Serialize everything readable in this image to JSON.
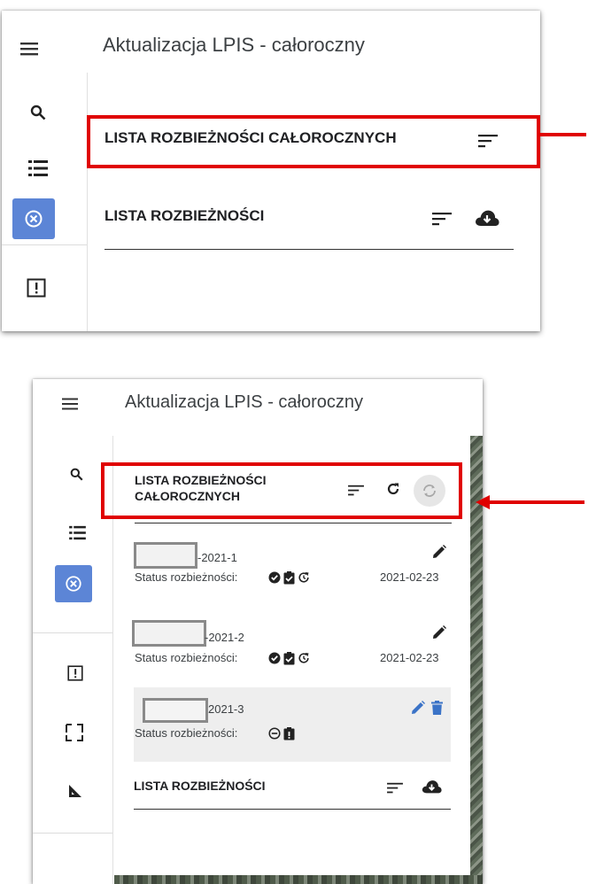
{
  "app": {
    "title": "Aktualizacja LPIS - całoroczny"
  },
  "panel_top": {
    "sections": [
      {
        "heading": "LISTA ROZBIEŻNOŚCI CAŁOROCZNYCH"
      },
      {
        "heading": "LISTA ROZBIEŻNOŚCI"
      }
    ]
  },
  "panel_bottom": {
    "section_primary": {
      "heading": "LISTA ROZBIEŻNOŚCI CAŁOROCZNYCH"
    },
    "items": [
      {
        "id_suffix": "-2021-1",
        "status_label": "Status rozbieżności:",
        "date": "2021-02-23"
      },
      {
        "id_suffix": "-2021-2",
        "status_label": "Status rozbieżności:",
        "date": "2021-02-23"
      },
      {
        "id_suffix": "2021-3",
        "status_label": "Status rozbieżności:",
        "date": ""
      }
    ],
    "section_secondary": {
      "heading": "LISTA ROZBIEŻNOŚCI"
    }
  },
  "colors": {
    "accent": "#5c85d6",
    "highlight": "#e00000",
    "selected_row_bg": "#eeeeee",
    "edit_blue": "#3b73c7"
  },
  "icons": [
    "menu-icon",
    "search-icon",
    "list-icon",
    "discrepancy-icon",
    "report-icon",
    "selection-icon",
    "measure-icon",
    "sort-icon",
    "cloud-download-icon",
    "refresh-icon",
    "sync-icon",
    "edit-icon",
    "delete-icon",
    "check-circle-icon",
    "clipboard-check-icon",
    "history-icon",
    "minus-circle-icon",
    "clipboard-alert-icon"
  ]
}
